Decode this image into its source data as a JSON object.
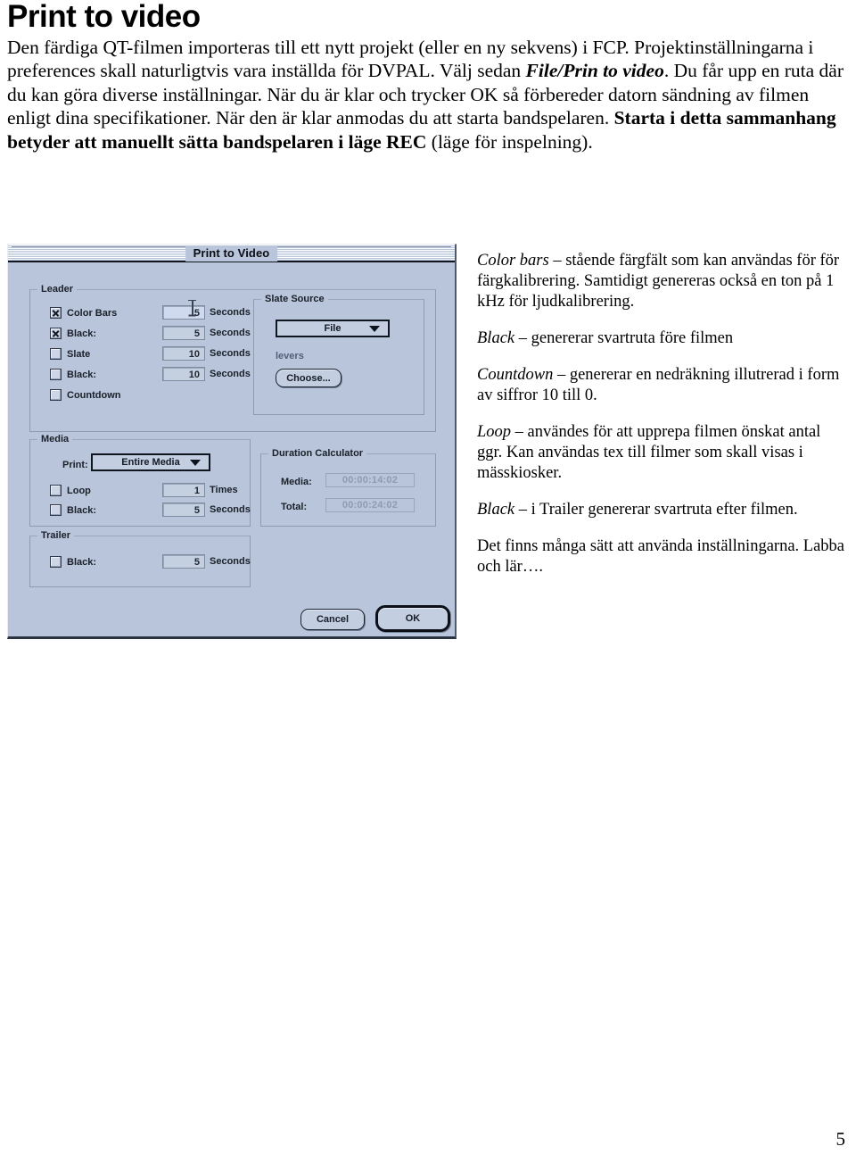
{
  "page": {
    "title": "Print to video",
    "number": "5"
  },
  "intro": {
    "seg1": "Den färdiga QT-filmen importeras till ett nytt projekt (eller en ny sekvens) i FCP. Projektinställningarna i preferences skall naturligtvis vara inställda för DVPAL. Välj sedan ",
    "seg2_bold_italic": "File/Prin to video",
    "seg3": ". Du får upp en ruta där du kan göra diverse inställningar. När du är klar och trycker OK så förbereder datorn sändning av filmen enligt dina specifikationer. När den är klar anmodas du att starta bandspelaren. ",
    "seg4_bold": "Starta i detta sammanhang betyder att manuellt sätta bandspelaren i läge REC",
    "seg5": " (läge för inspelning)."
  },
  "dialog": {
    "title": "Print to Video",
    "leader": {
      "legend": "Leader",
      "rows": [
        {
          "label": "Color Bars",
          "checked": true,
          "value": "5",
          "unit": "Seconds"
        },
        {
          "label": "Black:",
          "checked": true,
          "value": "5",
          "unit": "Seconds"
        },
        {
          "label": "Slate",
          "checked": false,
          "value": "10",
          "unit": "Seconds"
        },
        {
          "label": "Black:",
          "checked": false,
          "value": "10",
          "unit": "Seconds"
        },
        {
          "label": "Countdown",
          "checked": false,
          "value": "",
          "unit": ""
        }
      ]
    },
    "slate_source": {
      "legend": "Slate Source",
      "popup_value": "File",
      "filename": "levers",
      "choose_label": "Choose..."
    },
    "media": {
      "legend": "Media",
      "print_label": "Print:",
      "print_value": "Entire Media",
      "loop": {
        "label": "Loop",
        "checked": false,
        "value": "1",
        "unit": "Times"
      },
      "black": {
        "label": "Black:",
        "checked": false,
        "value": "5",
        "unit": "Seconds"
      }
    },
    "duration_calculator": {
      "legend": "Duration Calculator",
      "media_label": "Media:",
      "media_value": "00:00:14:02",
      "total_label": "Total:",
      "total_value": "00:00:24:02"
    },
    "trailer": {
      "legend": "Trailer",
      "black": {
        "label": "Black:",
        "checked": false,
        "value": "5",
        "unit": "Seconds"
      }
    },
    "buttons": {
      "cancel": "Cancel",
      "ok": "OK"
    }
  },
  "notes": [
    {
      "term": "Color bars",
      "text": " – stående färgfält som kan användas för för färgkalibrering. Samtidigt genereras också en ton på 1 kHz för ljudkalibrering."
    },
    {
      "term": "Black",
      "text": " – genererar svartruta före filmen"
    },
    {
      "term": "Countdown",
      "text": " – genererar en nedräkning illutrerad i form av siffror 10 till 0."
    },
    {
      "term": "Loop",
      "text": " – användes för att upprepa filmen önskat antal ggr. Kan användas tex till filmer som skall visas i mässkiosker."
    },
    {
      "term": "Black",
      "text": " – i Trailer genererar svartruta efter filmen."
    },
    {
      "term": "",
      "text": "Det finns många sätt att använda inställningarna. Labba och lär…."
    }
  ],
  "colors": {
    "dialog_bg": "#b9c5da",
    "field_bg": "#c4cfe0",
    "border_dark": "#101620",
    "text": "#1a2029"
  }
}
